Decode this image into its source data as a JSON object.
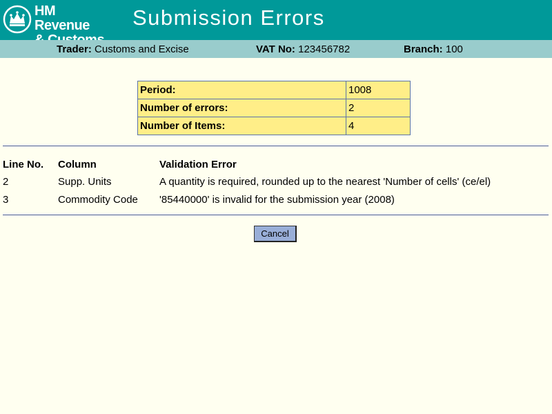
{
  "header": {
    "logo_line1": "HM Revenue",
    "logo_line2": "& Customs",
    "title": "Submission Errors"
  },
  "info": {
    "trader_label": "Trader:",
    "trader_value": "Customs and Excise",
    "vat_label": "VAT No:",
    "vat_value": "123456782",
    "branch_label": "Branch:",
    "branch_value": "100"
  },
  "summary": [
    {
      "label": "Period:",
      "value": "1008"
    },
    {
      "label": "Number of errors:",
      "value": "2"
    },
    {
      "label": "Number of Items:",
      "value": "4"
    }
  ],
  "errors": {
    "columns": [
      "Line No.",
      "Column",
      "Validation Error"
    ],
    "rows": [
      {
        "line": "2",
        "column": "Supp. Units",
        "error": "A quantity is required, rounded up to the nearest 'Number of cells' (ce/el)"
      },
      {
        "line": "3",
        "column": "Commodity Code",
        "error": "'85440000' is invalid for the submission year (2008)"
      }
    ]
  },
  "buttons": {
    "cancel": "Cancel"
  },
  "colors": {
    "header_bg": "#009999",
    "info_bar_bg": "#99cccc",
    "summary_bg": "#ffee88",
    "page_bg": "#fffff0",
    "button_bg": "#99aed8"
  }
}
